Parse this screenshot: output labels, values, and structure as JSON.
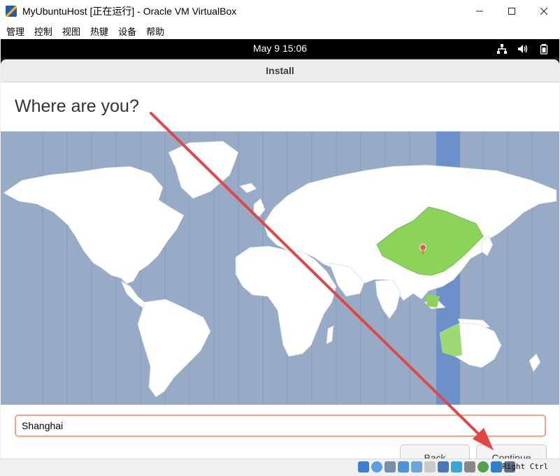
{
  "window": {
    "title": "MyUbuntuHost [正在运行] - Oracle VM VirtualBox",
    "controls": [
      "minimize",
      "maximize",
      "close"
    ]
  },
  "menubar": {
    "items": [
      "管理",
      "控制",
      "视图",
      "热键",
      "设备",
      "帮助"
    ]
  },
  "topbar": {
    "clock": "May 9  15:06",
    "tray_icons": [
      "network-icon",
      "volume-icon",
      "battery-icon"
    ]
  },
  "installer": {
    "header_title": "Install",
    "heading": "Where are you?",
    "timezone_value": "Shanghai",
    "selected_region": "China",
    "back_label": "Back",
    "continue_label": "Continue"
  },
  "statusbar": {
    "host_key": "Right Ctrl",
    "icons": [
      "hdd-icon",
      "optical-icon",
      "audio-icon",
      "network-icon",
      "usb-icon",
      "shared-folder-icon",
      "display-icon",
      "capture-icon",
      "recording-icon",
      "cpu-icon",
      "mouse-integration-icon",
      "keyboard-icon"
    ]
  },
  "colors": {
    "ocean": "#97aac6",
    "land": "#ffffff",
    "selected_region": "#8cd35a",
    "timezone_band": "#6c90c9",
    "annotation_arrow": "#e04848",
    "input_focus": "#f1a389"
  }
}
